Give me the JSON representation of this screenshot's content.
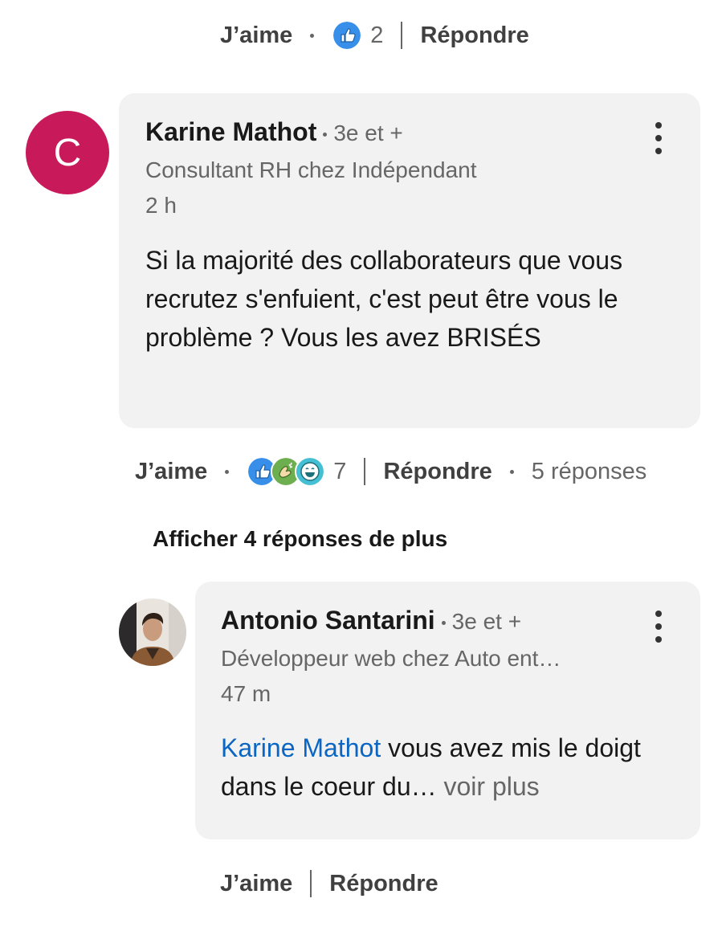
{
  "top_actions": {
    "like_label": "J’aime",
    "reaction_count": "2",
    "reply_label": "Répondre",
    "reaction_icons": [
      "like-icon"
    ]
  },
  "comment1": {
    "avatar_letter": "C",
    "avatar_color": "#c8195b",
    "author": "Karine Mathot",
    "degree": "3e et +",
    "headline": "Consultant RH chez Indépendant",
    "time": "2 h",
    "text": "Si la majorité des collaborateurs que vous recrutez s'enfuient, c'est peut être vous le problème ? Vous les avez BRISÉS",
    "actions": {
      "like_label": "J’aime",
      "reaction_count": "7",
      "reply_label": "Répondre",
      "replies_label": "5 réponses",
      "reaction_icons": [
        "like-icon",
        "celebrate-icon",
        "funny-icon"
      ]
    }
  },
  "load_more_label": "Afficher 4 réponses de plus",
  "reply1": {
    "author": "Antonio Santarini",
    "degree": "3e et +",
    "headline": "Développeur web chez Auto ent…",
    "time": "47 m",
    "mention": "Karine Mathot",
    "text": " vous avez mis le doigt dans le coeur du…",
    "see_more": " voir plus",
    "actions": {
      "like_label": "J’aime",
      "reply_label": "Répondre"
    }
  },
  "colors": {
    "accent_blue": "#0a66c2",
    "bubble_bg": "#f2f2f2",
    "muted_text": "#666666"
  }
}
